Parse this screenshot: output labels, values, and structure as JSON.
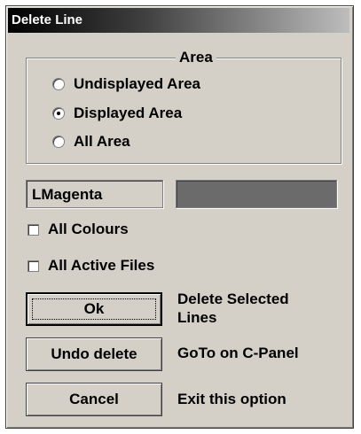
{
  "window": {
    "title": "Delete Line"
  },
  "area": {
    "title": "Area",
    "options": [
      {
        "label": "Undisplayed Area",
        "checked": false
      },
      {
        "label": "Displayed Area",
        "checked": true
      },
      {
        "label": "All Area",
        "checked": false
      }
    ]
  },
  "colour": {
    "value": "LMagenta",
    "swatch_color": "#6b6b6b"
  },
  "checkboxes": [
    {
      "label": "All Colours",
      "checked": false
    },
    {
      "label": "All Active Files",
      "checked": false
    }
  ],
  "actions": [
    {
      "button": "Ok",
      "description_line1": "Delete Selected",
      "description_line2": "Lines"
    },
    {
      "button": "Undo delete",
      "description_line1": "GoTo on C-Panel"
    },
    {
      "button": "Cancel",
      "description_line1": "Exit this option"
    }
  ]
}
